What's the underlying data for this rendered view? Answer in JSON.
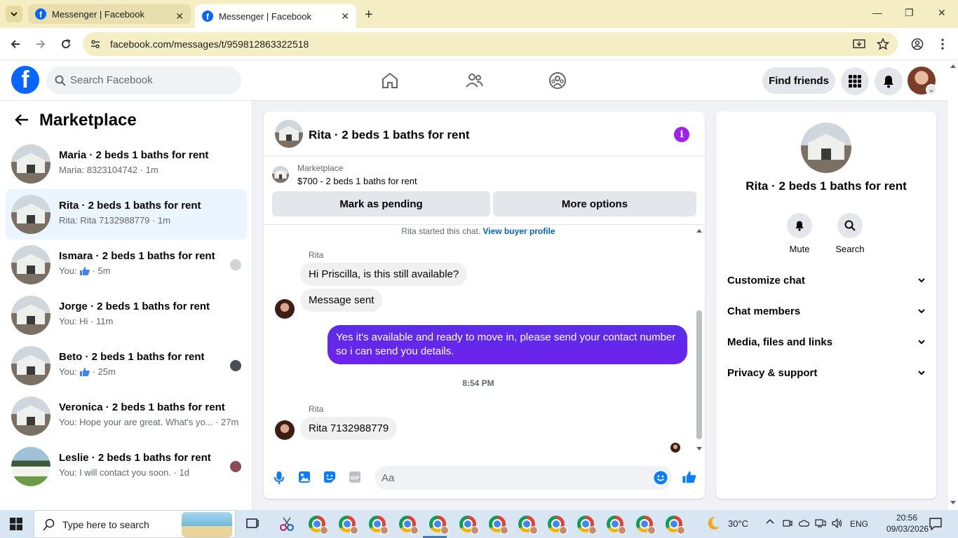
{
  "browser": {
    "tabs": [
      {
        "title": "Messenger | Facebook",
        "active": false
      },
      {
        "title": "Messenger | Facebook",
        "active": true
      }
    ],
    "url": "facebook.com/messages/t/959812863322518"
  },
  "fb_header": {
    "search_placeholder": "Search Facebook",
    "find_friends": "Find friends",
    "brand_color": "#0866ff"
  },
  "sidebar": {
    "title": "Marketplace",
    "conversations": [
      {
        "name": "Maria · 2 beds 1 baths for rent",
        "preview": "Maria: 8323104742 · 1m",
        "active": false
      },
      {
        "name": "Rita · 2 beds 1 baths for rent",
        "preview": "Rita: Rita 7132988779 · 1m",
        "active": true
      },
      {
        "name": "Ismara · 2 beds 1 baths for rent",
        "preview_prefix": "You:",
        "preview_suffix": "· 5m",
        "active": false
      },
      {
        "name": "Jorge · 2 beds 1 baths for rent",
        "preview": "You: Hi · 11m",
        "active": false
      },
      {
        "name": "Beto · 2 beds 1 baths for rent",
        "preview_prefix": "You:",
        "preview_suffix": "· 25m",
        "active": false
      },
      {
        "name": "Veronica · 2 beds 1 baths for rent",
        "preview": "You: Hope your are great. What's yo... · 27m",
        "active": false
      },
      {
        "name": "Leslie · 2 beds 1 baths for rent",
        "preview": "You: I will contact you soon. · 1d",
        "active": false
      }
    ]
  },
  "chat": {
    "title": "Rita · 2 beds 1 baths for rent",
    "marketplace_label": "Marketplace",
    "listing": "$700 - 2 beds 1 baths for rent",
    "mark_pending": "Mark as pending",
    "more_options": "More options",
    "system_text": "Rita started this chat.",
    "system_link": "View buyer profile",
    "sender_1": "Rita",
    "msg_1": "Hi Priscilla, is this still available?",
    "msg_2": "Message sent",
    "msg_3": "Yes it's available and ready to move in, please send your contact number so i can send you details.",
    "timestamp": "8:54 PM",
    "sender_2": "Rita",
    "msg_4": "Rita 7132988779",
    "input_placeholder": "Aa",
    "accent_color": "#6a1cf0"
  },
  "info_panel": {
    "title": "Rita · 2 beds 1 baths for rent",
    "mute": "Mute",
    "search": "Search",
    "sections": [
      "Customize chat",
      "Chat members",
      "Media, files and links",
      "Privacy & support"
    ]
  },
  "taskbar": {
    "search_placeholder": "Type here to search",
    "weather": "30°C",
    "language": "ENG",
    "time": "20:56",
    "date": "09/03/2026"
  }
}
